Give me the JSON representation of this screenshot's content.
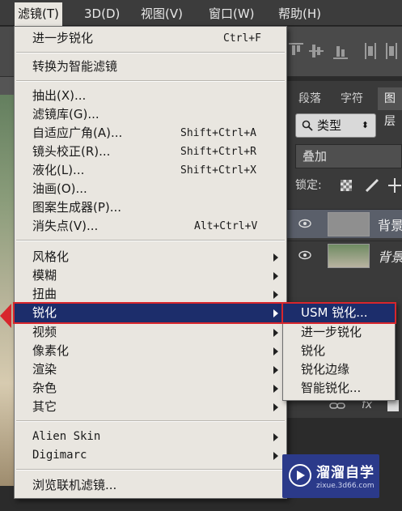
{
  "menubar": {
    "items": [
      {
        "label": "滤镜(T)"
      },
      {
        "label": "3D(D)"
      },
      {
        "label": "视图(V)"
      },
      {
        "label": "窗口(W)"
      },
      {
        "label": "帮助(H)"
      }
    ]
  },
  "filter_menu": {
    "items": [
      {
        "label": "进一步锐化",
        "shortcut": "Ctrl+F"
      },
      {
        "label": "转换为智能滤镜"
      },
      {
        "label": "抽出(X)..."
      },
      {
        "label": "滤镜库(G)..."
      },
      {
        "label": "自适应广角(A)...",
        "shortcut": "Shift+Ctrl+A"
      },
      {
        "label": "镜头校正(R)...",
        "shortcut": "Shift+Ctrl+R"
      },
      {
        "label": "液化(L)...",
        "shortcut": "Shift+Ctrl+X"
      },
      {
        "label": "油画(O)..."
      },
      {
        "label": "图案生成器(P)..."
      },
      {
        "label": "消失点(V)...",
        "shortcut": "Alt+Ctrl+V"
      },
      {
        "label": "风格化"
      },
      {
        "label": "模糊"
      },
      {
        "label": "扭曲"
      },
      {
        "label": "锐化"
      },
      {
        "label": "视频"
      },
      {
        "label": "像素化"
      },
      {
        "label": "渲染"
      },
      {
        "label": "杂色"
      },
      {
        "label": "其它"
      },
      {
        "label": "Alien Skin"
      },
      {
        "label": "Digimarc"
      },
      {
        "label": "浏览联机滤镜..."
      }
    ]
  },
  "sharpen_submenu": {
    "items": [
      {
        "label": "USM 锐化..."
      },
      {
        "label": "进一步锐化"
      },
      {
        "label": "锐化"
      },
      {
        "label": "锐化边缘"
      },
      {
        "label": "智能锐化..."
      }
    ]
  },
  "layers_panel": {
    "tabs": [
      {
        "label": "段落"
      },
      {
        "label": "字符"
      },
      {
        "label": "图层"
      }
    ],
    "filter_kind": "类型",
    "blend_mode": "叠加",
    "lock_label": "锁定:",
    "layers": [
      {
        "name": "背景"
      },
      {
        "name": "背景"
      }
    ]
  },
  "watermark": {
    "title": "溜溜自学",
    "url": "zixue.3d66.com"
  }
}
